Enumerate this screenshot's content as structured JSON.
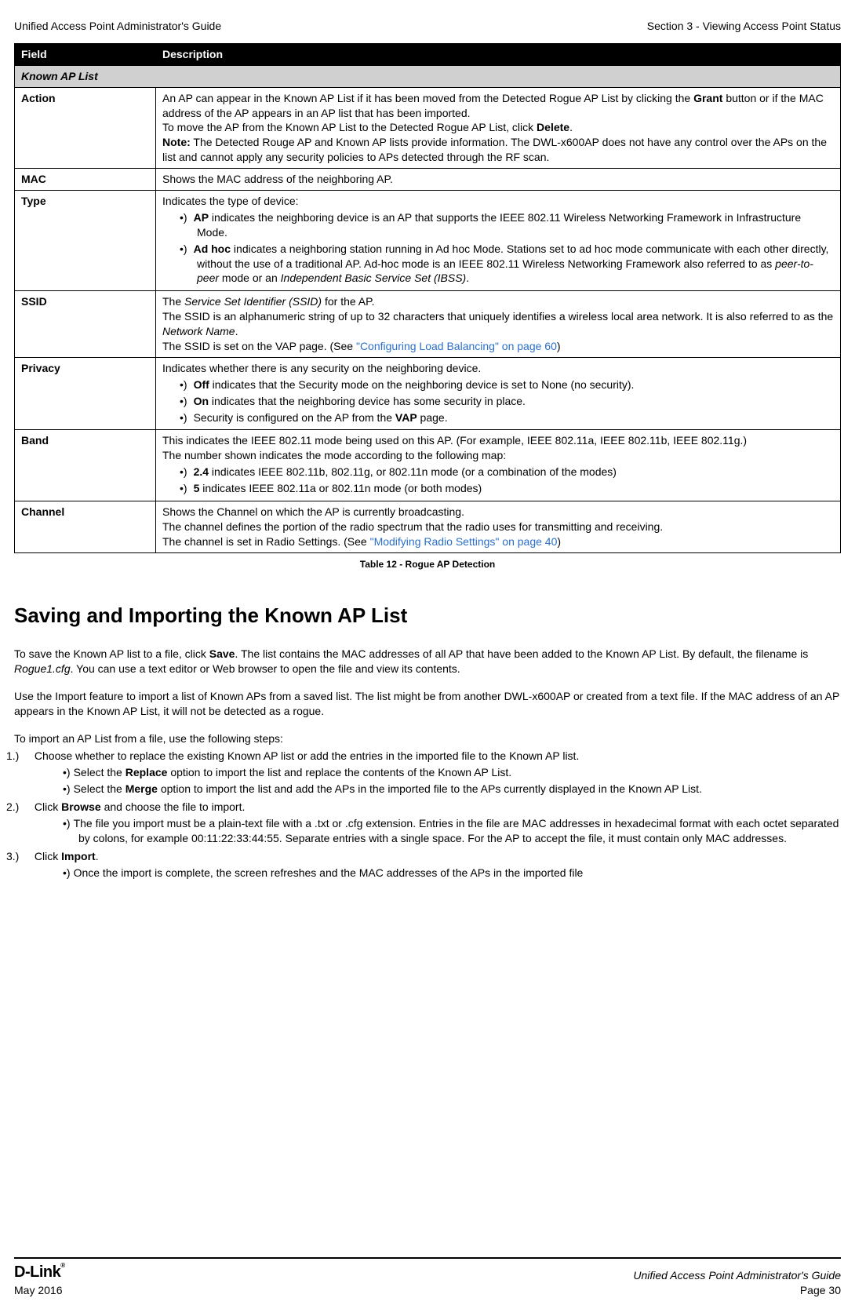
{
  "header": {
    "left": "Unified Access Point Administrator's Guide",
    "right": "Section 3 - Viewing Access Point Status"
  },
  "table": {
    "head": {
      "field": "Field",
      "desc": "Description"
    },
    "subheader": "Known AP List",
    "rows": {
      "action": {
        "label": "Action"
      },
      "mac": {
        "label": "MAC",
        "desc": "Shows the MAC address of the neighboring AP."
      },
      "type": {
        "label": "Type"
      },
      "ssid": {
        "label": "SSID"
      },
      "privacy": {
        "label": "Privacy"
      },
      "band": {
        "label": "Band"
      },
      "channel": {
        "label": "Channel"
      }
    }
  },
  "action": {
    "p1a": "An AP can appear in the Known AP List if it has been moved from the Detected Rogue AP List by clicking the ",
    "p1b": "Grant",
    "p1c": " button or if the MAC address of the AP appears in an AP list that has been imported.",
    "p2a": "To move the AP from the Known AP List to the Detected Rogue AP List, click ",
    "p2b": "Delete",
    "p2c": ".",
    "p3a": "Note:",
    "p3b": " The Detected Rouge AP and Known AP lists provide information. The DWL-x600AP does not have any control over the APs on the list and cannot apply any security policies to APs detected through the RF scan."
  },
  "type": {
    "intro": "Indicates the type of device:",
    "b1a": "AP",
    "b1b": " indicates the neighboring device is an AP that supports the IEEE 802.11 Wireless Networking Framework in Infrastructure Mode.",
    "b2a": "Ad hoc",
    "b2b": " indicates a neighboring station running in Ad hoc Mode. Stations set to ad hoc mode communicate with each other directly, without the use of a traditional AP. Ad-hoc mode is an IEEE 802.11 Wireless Networking Framework also referred to as ",
    "b2c": "peer-to-peer",
    "b2d": " mode or an ",
    "b2e": "Independent Basic Service Set (IBSS)",
    "b2f": "."
  },
  "ssid": {
    "p1a": "The ",
    "p1b": "Service Set Identifier (SSID)",
    "p1c": " for the AP.",
    "p2a": "The SSID is an alphanumeric string of up to 32 characters that uniquely identifies a wireless local area network. It is also referred to as the ",
    "p2b": "Network Name",
    "p2c": ".",
    "p3a": "The SSID is set on the VAP page. (See ",
    "p3b": "\"Configuring Load Balancing\" on page 60",
    "p3c": ")"
  },
  "privacy": {
    "intro": "Indicates whether there is any security on the neighboring device.",
    "b1a": "Off",
    "b1b": " indicates that the Security mode on the neighboring device is set to None (no security).",
    "b2a": "On",
    "b2b": " indicates that the neighboring device has some security in place.",
    "b3a": "Security is configured on the AP from the ",
    "b3b": "VAP",
    "b3c": " page."
  },
  "band": {
    "p1": "This indicates the IEEE 802.11 mode being used on this AP. (For example, IEEE 802.11a, IEEE 802.11b, IEEE 802.11g.)",
    "p2": "The number shown indicates the mode according to the following map:",
    "b1a": "2.4",
    "b1b": " indicates IEEE 802.11b, 802.11g, or 802.11n mode (or a combination of the modes)",
    "b2a": "5",
    "b2b": " indicates IEEE 802.11a or 802.11n mode (or both modes)"
  },
  "channel": {
    "p1": "Shows the Channel on which the AP is currently broadcasting.",
    "p2": "The channel defines the portion of the radio spectrum that the radio uses for transmitting and receiving.",
    "p3a": "The channel is set in Radio Settings. (See ",
    "p3b": "\"Modifying Radio Settings\" on page 40",
    "p3c": ")"
  },
  "caption": "Table 12 - Rogue AP Detection",
  "section_title": "Saving and Importing the Known AP List",
  "para1": {
    "a": "To save the Known AP list to a file, click ",
    "b": "Save",
    "c": ". The list contains the MAC addresses of all AP that have been added to the Known AP List. By default, the filename is ",
    "d": "Rogue1.cfg",
    "e": ". You can use a text editor or Web browser to open the file and view its contents."
  },
  "para2": "Use the Import feature to import a list of Known APs from a saved list. The list might be from another DWL-x600AP or created from a text file. If the MAC address of an AP appears in the Known AP List, it will not be detected as a rogue.",
  "para3": "To import an AP List from a file, use the following steps:",
  "step1": {
    "main": "Choose whether to replace the existing Known AP list or add the entries in the imported file to the Known AP list.",
    "sub1a": "Select the ",
    "sub1b": "Replace",
    "sub1c": " option to import the list and replace the contents of the Known AP List.",
    "sub2a": "Select the ",
    "sub2b": "Merge",
    "sub2c": " option to import the list and add the APs in the imported file to the APs currently displayed in the Known AP List."
  },
  "step2": {
    "main_a": "Click ",
    "main_b": "Browse",
    "main_c": " and choose the file to import.",
    "sub1": "The file you import must be a plain-text file with a .txt or .cfg extension. Entries in the file are MAC addresses in hexadecimal format with each octet separated by colons, for example 00:11:22:33:44:55. Separate entries with a single space. For the AP to accept the file, it must contain only MAC addresses."
  },
  "step3": {
    "main_a": "Click ",
    "main_b": "Import",
    "main_c": ".",
    "sub1": "Once the import is complete, the screen refreshes and the MAC addresses of the APs in the imported file"
  },
  "footer": {
    "logo": "D-Link",
    "date": "May 2016",
    "right_title": "Unified Access Point Administrator's Guide",
    "page": "Page 30"
  }
}
